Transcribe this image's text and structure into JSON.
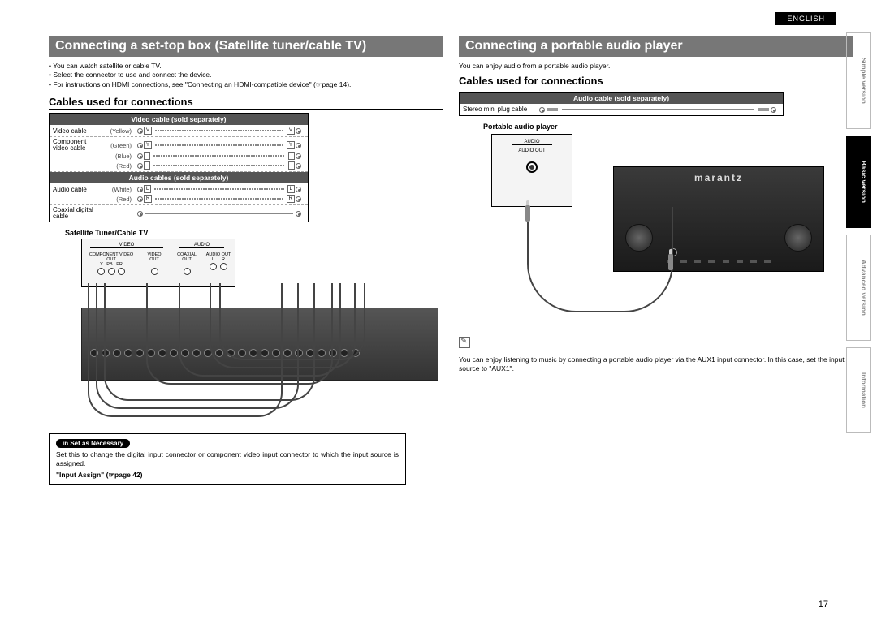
{
  "language": "ENGLISH",
  "side_tabs": {
    "simple": "Simple version",
    "basic": "Basic version",
    "advanced": "Advanced version",
    "info": "Information"
  },
  "left": {
    "title": "Connecting a set-top box (Satellite tuner/cable TV)",
    "bullets": [
      "You can watch satellite or cable TV.",
      "Select the connector to use and connect the device.",
      "For instructions on HDMI connections, see \"Connecting an HDMI-compatible device\" (☞page 14)."
    ],
    "cables_heading": "Cables used for connections",
    "video_hdr": "Video cable (sold separately)",
    "audio_hdr": "Audio cables (sold separately)",
    "rows": {
      "video_cable": "Video cable",
      "component": "Component video cable",
      "audio_cable": "Audio cable",
      "coax": "Coaxial digital cable"
    },
    "colors": {
      "yellow": "(Yellow)",
      "green": "(Green)",
      "blue": "(Blue)",
      "red": "(Red)",
      "white": "(White)"
    },
    "tags": {
      "v": "V",
      "y": "Y",
      "l": "L",
      "r": "R"
    },
    "device_label": "Satellite Tuner/Cable TV",
    "device_ports": {
      "video_grp": "VIDEO",
      "audio_grp": "AUDIO",
      "comp_out": "COMPONENT VIDEO OUT",
      "comp_labels": "Y   PB   PR",
      "video_out": "VIDEO OUT",
      "coax_out": "COAXIAL OUT",
      "audio_out": "AUDIO OUT",
      "audio_labels": "L      R"
    },
    "note": {
      "pill": "in Set as Necessary",
      "text": "Set this to change the digital input connector or component video input connector to which the input source is assigned.",
      "ref": "\"Input Assign\" (☞page 42)"
    }
  },
  "right": {
    "title": "Connecting a portable audio player",
    "intro": "You can enjoy audio from a portable audio player.",
    "cables_heading": "Cables used for connections",
    "audio_hdr": "Audio cable (sold separately)",
    "row_name": "Stereo mini plug cable",
    "device_label": "Portable audio player",
    "pap_labels": {
      "audio": "AUDIO",
      "out": "AUDIO OUT"
    },
    "brand": "marantz",
    "note": "You can enjoy listening to music by connecting a portable audio player via the AUX1 input connector. In this case, set the input source to \"AUX1\"."
  },
  "page_number": "17"
}
